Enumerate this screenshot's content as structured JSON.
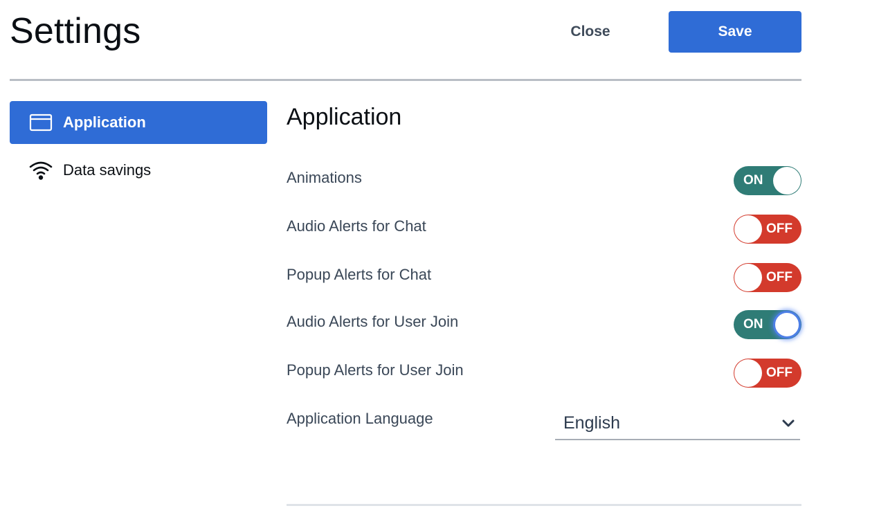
{
  "header": {
    "title": "Settings",
    "close_label": "Close",
    "save_label": "Save"
  },
  "sidebar": {
    "items": [
      {
        "label": "Application",
        "icon": "application-window-icon",
        "active": true
      },
      {
        "label": "Data savings",
        "icon": "wifi-icon",
        "active": false
      }
    ]
  },
  "main": {
    "section_title": "Application",
    "settings": [
      {
        "label": "Animations",
        "state": "ON"
      },
      {
        "label": "Audio Alerts for Chat",
        "state": "OFF"
      },
      {
        "label": "Popup Alerts for Chat",
        "state": "OFF"
      },
      {
        "label": "Audio Alerts for User Join",
        "state": "ON"
      },
      {
        "label": "Popup Alerts for User Join",
        "state": "OFF"
      }
    ],
    "language": {
      "label": "Application Language",
      "value": "English"
    }
  },
  "colors": {
    "accent": "#2f6cd6",
    "toggle_on": "#2f7c76",
    "toggle_off": "#d33a2c"
  }
}
